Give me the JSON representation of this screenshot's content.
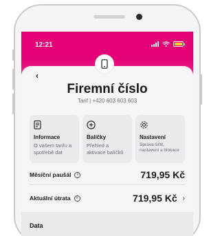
{
  "status_bar": {
    "time": "12:21",
    "icons": [
      "signal-icon",
      "wifi-icon",
      "battery-icon"
    ]
  },
  "header": {
    "device_icon": "smartphone-icon",
    "back_icon": "back-arrow-icon",
    "back_glyph": "‹",
    "title": "Firemní číslo",
    "subtitle": "Tarif | +420 603 603 603"
  },
  "tiles": [
    {
      "icon": "document-icon",
      "title": "Informace",
      "description": "O vašem tarifu a spotřebě dat"
    },
    {
      "icon": "plus-circle-icon",
      "title": "Balíčky",
      "description": "Přehled a aktivace balíčků"
    },
    {
      "icon": "gear-icon",
      "title": "Nastavení",
      "description": "Správa SIM, nastavení a blokace"
    }
  ],
  "rows": {
    "monthly_fee": {
      "label": "Měsíční paušál",
      "value": "719,95 Kč",
      "info_glyph": "i"
    },
    "current_spend": {
      "label": "Aktuální útrata",
      "value": "719,95 Kč",
      "info_glyph": "i",
      "chevron": "›"
    }
  },
  "data_section": {
    "label": "Data"
  },
  "colors": {
    "brand": "#e20074",
    "battery": "#f5d020",
    "background": "#f6f4f7"
  }
}
